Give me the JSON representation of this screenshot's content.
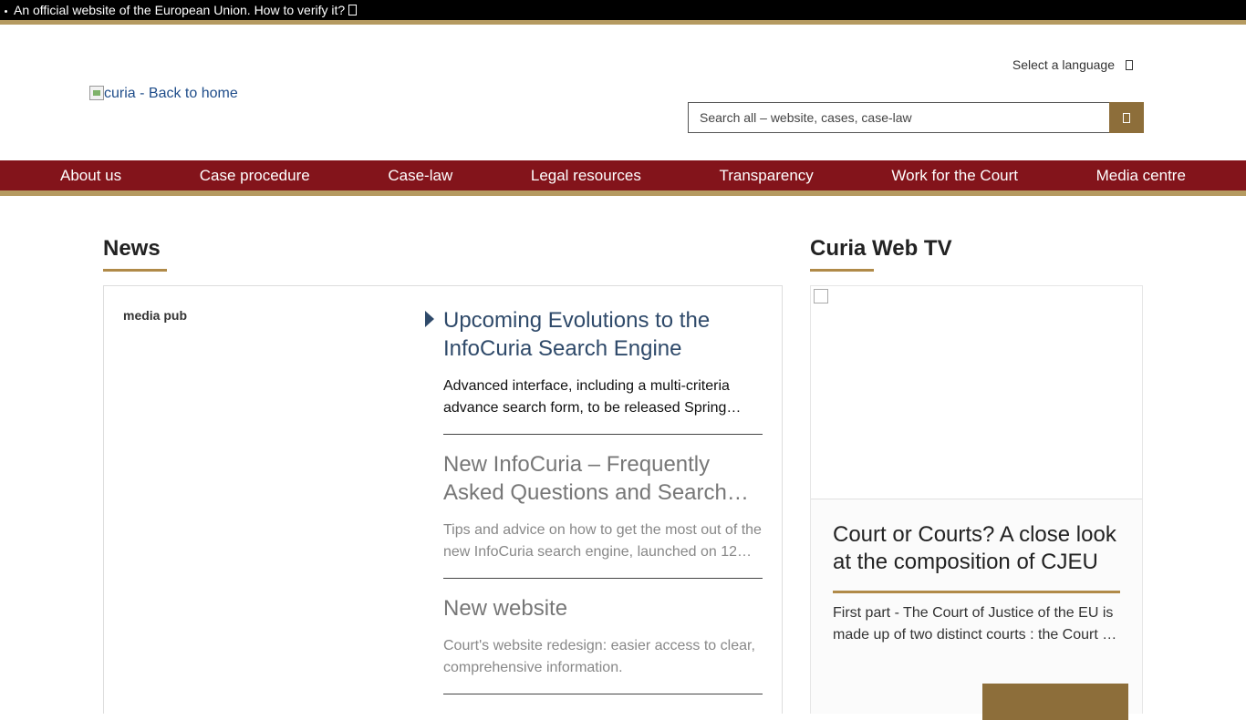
{
  "eu_banner": {
    "text": "An official website of the European Union. How to verify it?"
  },
  "header": {
    "logo_text": "curia - Back to home",
    "language_label": "Select a language",
    "search_placeholder": "Search all – website, cases, case-law"
  },
  "nav": {
    "items": [
      "About us",
      "Case procedure",
      "Case-law",
      "Legal resources",
      "Transparency",
      "Work for the Court",
      "Media centre"
    ]
  },
  "news": {
    "title": "News",
    "image_alt": "media pub",
    "items": [
      {
        "title": "Upcoming Evolutions to the InfoCuria Search Engine",
        "desc": "Advanced interface, including a multi-criteria advance search form, to be released Spring…"
      },
      {
        "title": "New InfoCuria – Frequently Asked Questions and Search…",
        "desc": "Tips and advice on how to get the most out of the new InfoCuria search engine, launched on 12…"
      },
      {
        "title": "New website",
        "desc": "Court's website redesign: easier access to clear, comprehensive information."
      }
    ]
  },
  "web_tv": {
    "title": "Curia Web TV",
    "video_title": "Court or Courts? A close look at the composition of CJEU",
    "video_desc": "First part - The Court of Justice of the EU is made up of two distinct courts : the Court …"
  },
  "colors": {
    "nav_bg": "#83141b",
    "gold": "#b59a60",
    "button_brown": "#8d6e3a"
  }
}
